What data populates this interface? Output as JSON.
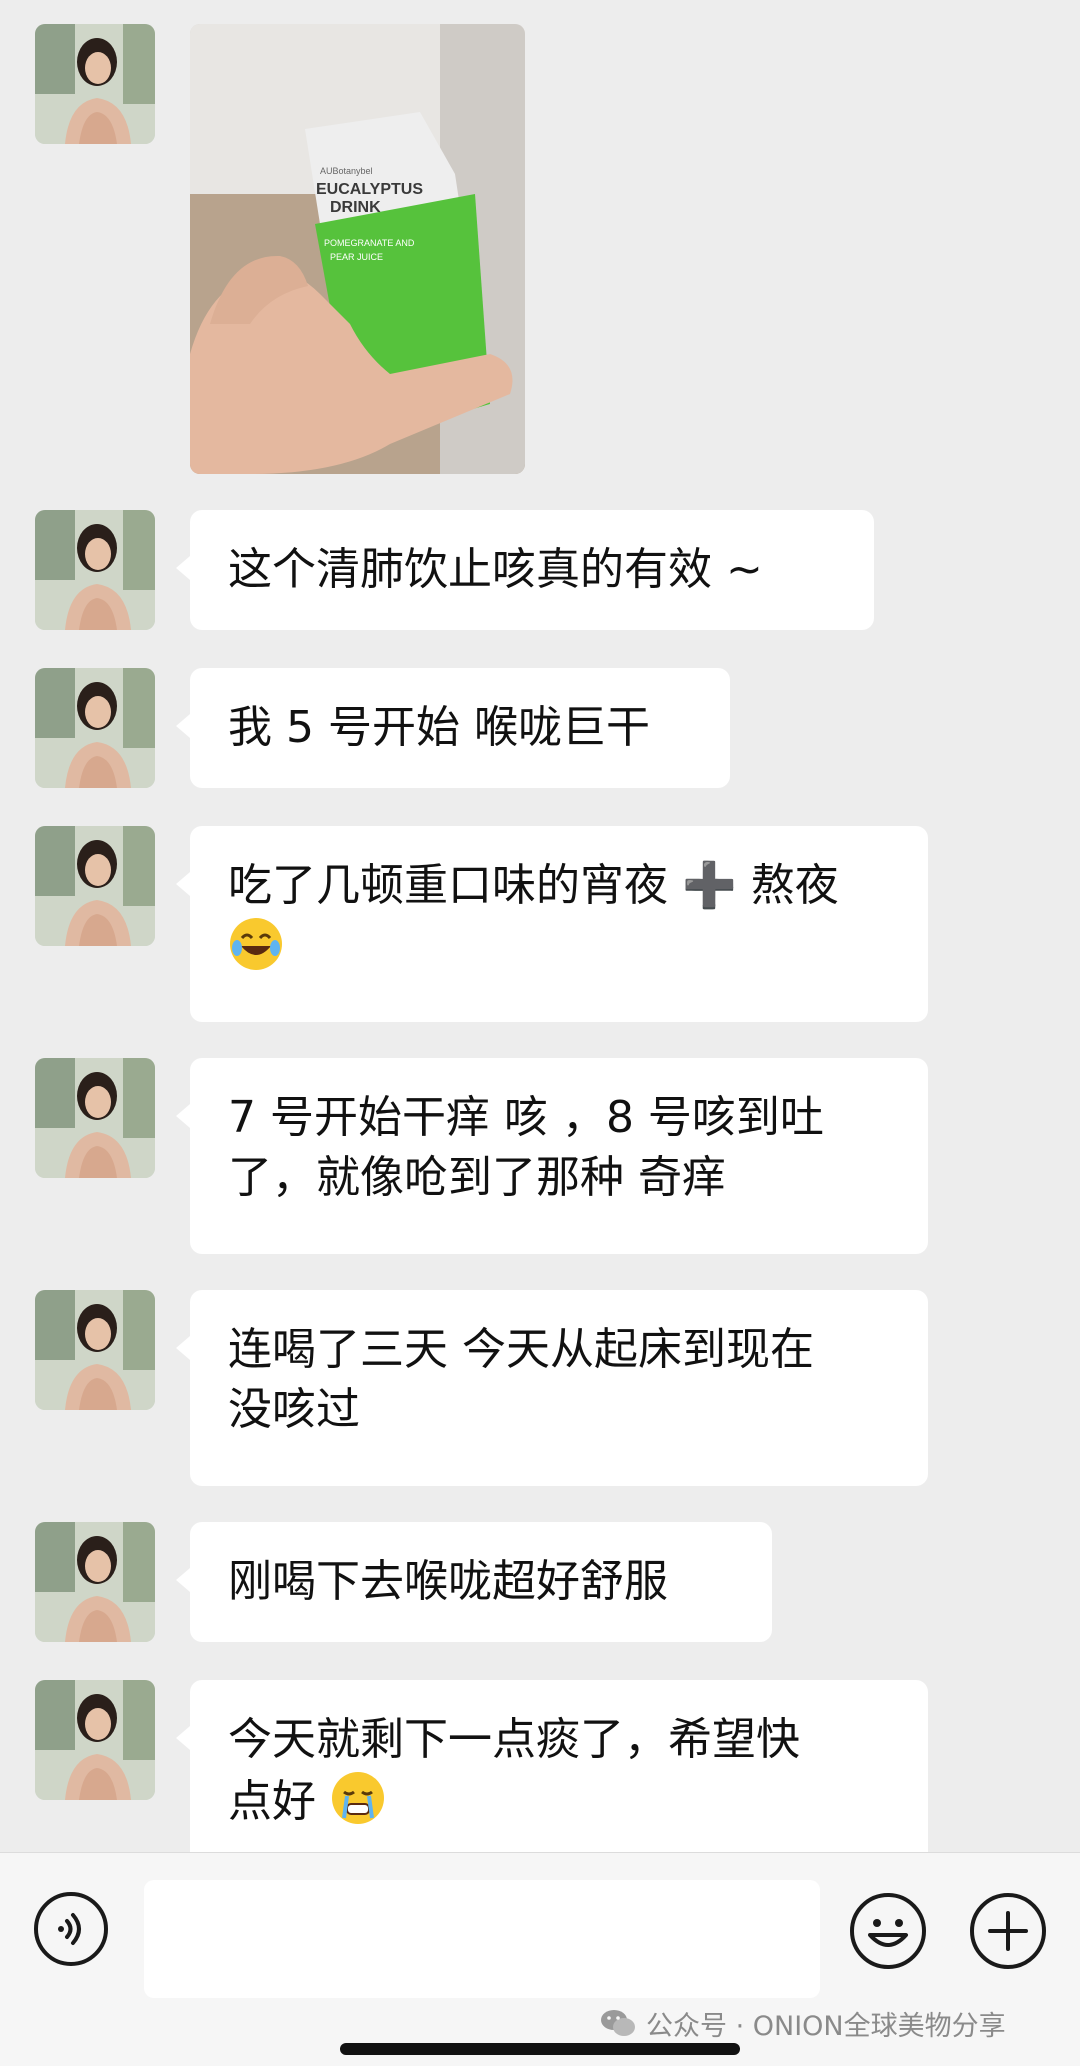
{
  "messages": [
    {
      "type": "image",
      "product_text": [
        "AUBotanybel",
        "EUCALYPTUS",
        "DRINK",
        "POMEGRANATE AND",
        "PEAR JUICE"
      ]
    },
    {
      "type": "text",
      "lines": [
        "这个清肺饮止咳真的有效 ~"
      ]
    },
    {
      "type": "text",
      "lines": [
        "我 5 号开始 喉咙巨干"
      ]
    },
    {
      "type": "text",
      "lines": [
        "吃了几顿重口味的宵夜 ➕ 熬夜"
      ],
      "emoji": "laugh-cry-emoji"
    },
    {
      "type": "text",
      "lines": [
        "7 号开始干痒 咳 ，8 号咳到吐",
        "了，就像呛到了那种 奇痒"
      ]
    },
    {
      "type": "text",
      "lines": [
        "连喝了三天 今天从起床到现在",
        "没咳过"
      ]
    },
    {
      "type": "text",
      "lines": [
        "刚喝下去喉咙超好舒服"
      ]
    },
    {
      "type": "text",
      "lines": [
        "今天就剩下一点痰了，希望快",
        "点好"
      ],
      "emoji": "tearful-emoji"
    }
  ],
  "input": {
    "value": "",
    "placeholder": ""
  },
  "watermark": {
    "text": "公众号 · ONION全球美物分享",
    "icon": "wechat-icon"
  },
  "colors": {
    "background": "#ededed",
    "bubble": "#ffffff",
    "product_green": "#56c23c"
  }
}
